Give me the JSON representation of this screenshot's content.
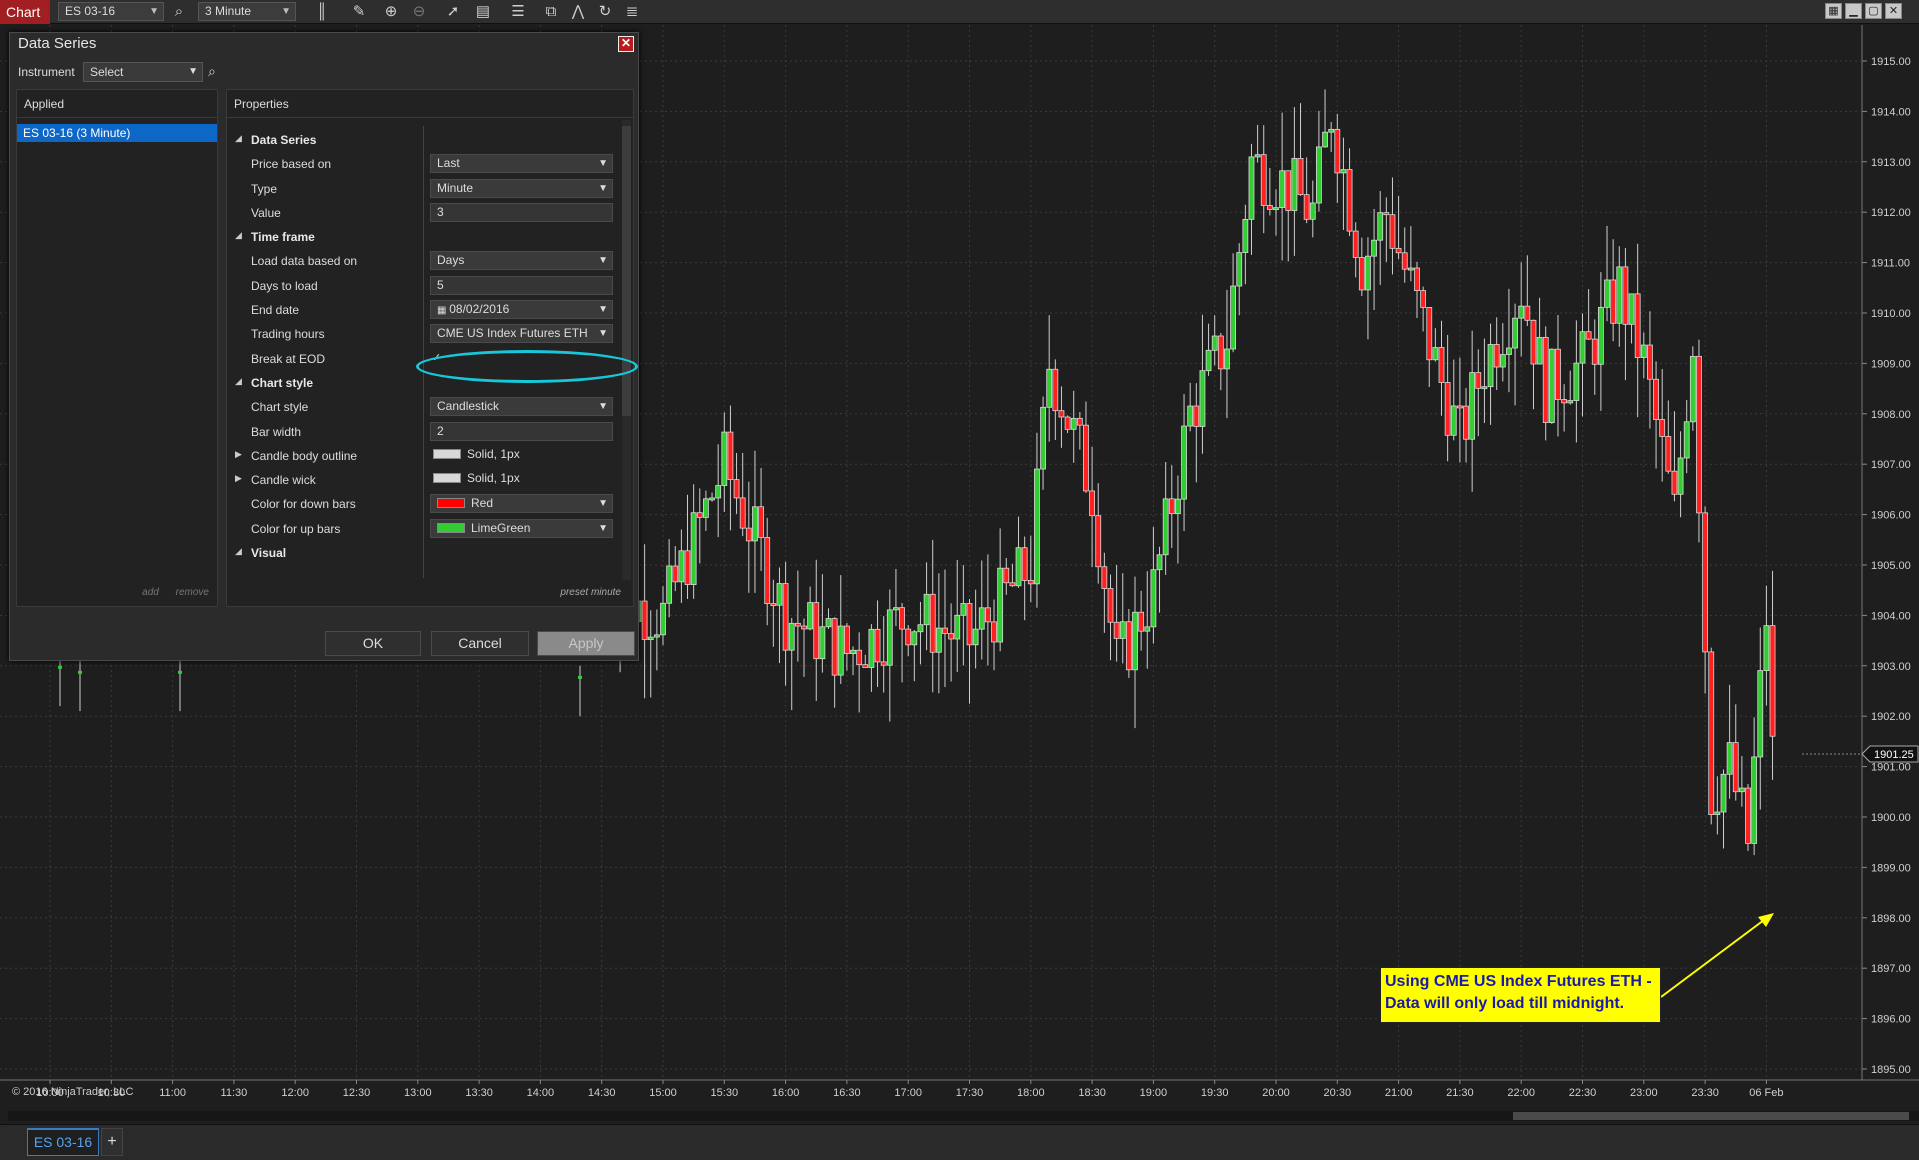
{
  "toolbar": {
    "chart_tab": "Chart",
    "instrument": "ES 03-16",
    "interval": "3 Minute"
  },
  "dialog": {
    "title": "Data Series",
    "instrument_label": "Instrument",
    "instrument_select": "Select",
    "applied_header": "Applied",
    "applied_item": "ES 03-16 (3 Minute)",
    "add_label": "add",
    "remove_label": "remove",
    "properties_header": "Properties",
    "preset_label": "preset minute",
    "ok_label": "OK",
    "cancel_label": "Cancel",
    "apply_label": "Apply",
    "rows": [
      {
        "kind": "cat",
        "label": "Data Series"
      },
      {
        "kind": "select",
        "label": "Price based on",
        "value": "Last"
      },
      {
        "kind": "select",
        "label": "Type",
        "value": "Minute"
      },
      {
        "kind": "text",
        "label": "Value",
        "value": "3"
      },
      {
        "kind": "cat",
        "label": "Time frame"
      },
      {
        "kind": "select",
        "label": "Load data based on",
        "value": "Days"
      },
      {
        "kind": "text",
        "label": "Days to load",
        "value": "5"
      },
      {
        "kind": "date",
        "label": "End date",
        "value": "08/02/2016"
      },
      {
        "kind": "select",
        "label": "Trading hours",
        "value": "CME US Index Futures ETH"
      },
      {
        "kind": "check",
        "label": "Break at EOD",
        "value": "✓"
      },
      {
        "kind": "cat",
        "label": "Chart style"
      },
      {
        "kind": "select",
        "label": "Chart style",
        "value": "Candlestick"
      },
      {
        "kind": "text",
        "label": "Bar width",
        "value": "2"
      },
      {
        "kind": "stroke",
        "label": "Candle body outline",
        "value": "Solid, 1px",
        "swatch": "#d8d8d8"
      },
      {
        "kind": "stroke",
        "label": "Candle wick",
        "value": "Solid, 1px",
        "swatch": "#d8d8d8"
      },
      {
        "kind": "color",
        "label": "Color for down bars",
        "value": "Red",
        "swatch": "#ff0000"
      },
      {
        "kind": "color",
        "label": "Color for up bars",
        "value": "LimeGreen",
        "swatch": "#32cd32"
      },
      {
        "kind": "cat",
        "label": "Visual"
      }
    ]
  },
  "chart": {
    "copyright": "© 2016 NinjaTrader, LLC",
    "current_price": "1901.25",
    "price_axis": [
      "1915.00",
      "1914.00",
      "1913.00",
      "1912.00",
      "1911.00",
      "1910.00",
      "1909.00",
      "1908.00",
      "1907.00",
      "1906.00",
      "1905.00",
      "1904.00",
      "1903.00",
      "1902.00",
      "1901.00",
      "1900.00",
      "1899.00",
      "1898.00",
      "1897.00",
      "1896.00",
      "1895.00"
    ],
    "time_axis": [
      "10:00",
      "10:30",
      "11:00",
      "11:30",
      "12:00",
      "12:30",
      "13:00",
      "13:30",
      "14:00",
      "14:30",
      "15:00",
      "15:30",
      "16:00",
      "16:30",
      "17:00",
      "17:30",
      "18:00",
      "18:30",
      "19:00",
      "19:30",
      "20:00",
      "20:30",
      "21:00",
      "21:30",
      "22:00",
      "22:30",
      "23:00",
      "23:30",
      "06 Feb"
    ],
    "annotation_line1": "Using CME US Index Futures ETH -",
    "annotation_line2": "Data will only load till midnight.",
    "up_color": "#32cd32",
    "down_color": "#ff2020"
  },
  "chart_data": {
    "type": "candlestick",
    "ylim": [
      1894.5,
      1916
    ],
    "x_labels": [
      "10:00",
      "10:30",
      "11:00",
      "11:30",
      "12:00",
      "12:30",
      "13:00",
      "13:30",
      "14:00",
      "14:30",
      "15:00",
      "15:30",
      "16:00",
      "16:30",
      "17:00",
      "17:30",
      "18:00",
      "18:30",
      "19:00",
      "19:30",
      "20:00",
      "20:30",
      "21:00",
      "21:30",
      "22:00",
      "22:30",
      "23:00",
      "23:30",
      "06 Feb"
    ],
    "close_path": [
      [
        14.5,
        1904.5
      ],
      [
        15.0,
        1904.0
      ],
      [
        15.5,
        1907.0
      ],
      [
        16.0,
        1904.0
      ],
      [
        16.5,
        1903.25
      ],
      [
        17.0,
        1904.0
      ],
      [
        17.5,
        1903.5
      ],
      [
        18.0,
        1905.0
      ],
      [
        18.15,
        1909.0
      ],
      [
        18.5,
        1906.5
      ],
      [
        18.7,
        1903.0
      ],
      [
        19.0,
        1904.5
      ],
      [
        19.3,
        1908.0
      ],
      [
        19.6,
        1909.5
      ],
      [
        19.8,
        1913.0
      ],
      [
        20.1,
        1912.5
      ],
      [
        20.3,
        1912.0
      ],
      [
        20.45,
        1914.0
      ],
      [
        20.7,
        1911.0
      ],
      [
        20.9,
        1912.0
      ],
      [
        21.1,
        1910.5
      ],
      [
        21.3,
        1909.0
      ],
      [
        21.5,
        1907.5
      ],
      [
        21.7,
        1909.0
      ],
      [
        22.0,
        1910.5
      ],
      [
        22.2,
        1908.5
      ],
      [
        22.5,
        1909.0
      ],
      [
        22.8,
        1910.5
      ],
      [
        23.0,
        1909.0
      ],
      [
        23.25,
        1906.0
      ],
      [
        23.4,
        1909.5
      ],
      [
        23.55,
        1900.5
      ],
      [
        23.7,
        1901.0
      ],
      [
        23.85,
        1899.5
      ],
      [
        24.0,
        1904.0
      ],
      [
        24.05,
        1901.25
      ]
    ],
    "current_price": 1901.25
  }
}
